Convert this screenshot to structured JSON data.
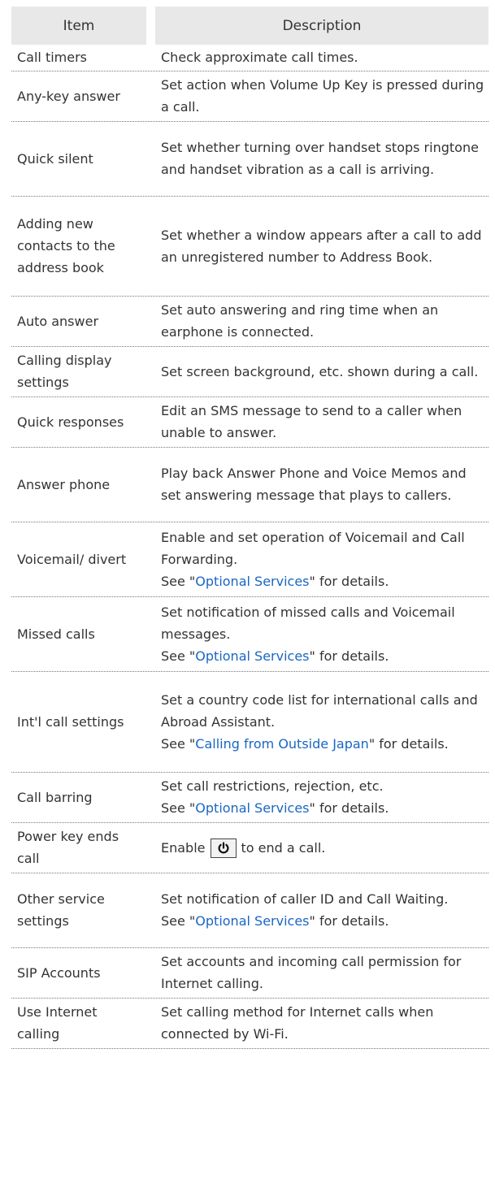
{
  "header": {
    "item": "Item",
    "description": "Description"
  },
  "rows": [
    {
      "item": "Call timers",
      "desc": "Check approximate call times."
    },
    {
      "item": "Any-key answer",
      "desc": "Set action when Volume Up Key is pressed during a call."
    },
    {
      "item": "Quick silent",
      "desc": "Set whether turning over handset stops ringtone and handset vibration as a call is arriving."
    },
    {
      "item": "Adding new contacts to the address book",
      "desc": "Set whether a window appears after a call to add an unregistered number to Address Book."
    },
    {
      "item": "Auto answer",
      "desc": "Set auto answering and ring time when an earphone is connected."
    },
    {
      "item": "Calling display settings",
      "desc": "Set screen background, etc. shown during a call."
    },
    {
      "item": "Quick responses",
      "desc": "Edit an SMS message to send to a caller when unable to answer."
    },
    {
      "item": "Answer phone",
      "desc": "Play back Answer Phone and Voice Memos and set answering message that plays to callers."
    },
    {
      "item": "Voicemail/ divert",
      "desc": "Enable and set operation of Voicemail and Call Forwarding.",
      "see_prefix": "See \"",
      "see_link": "Optional Services",
      "see_suffix": "\" for details."
    },
    {
      "item": "Missed calls",
      "desc": "Set notification of missed calls and Voicemail messages.",
      "see_prefix": "See \"",
      "see_link": "Optional Services",
      "see_suffix": "\" for details."
    },
    {
      "item": "Int'l call settings",
      "desc": "Set a country code list for international calls and Abroad Assistant.",
      "see_prefix": "See \"",
      "see_link": "Calling from Outside Japan",
      "see_suffix": "\" for details."
    },
    {
      "item": "Call barring",
      "desc": "Set call restrictions, rejection, etc.",
      "see_prefix": "See \"",
      "see_link": "Optional Services",
      "see_suffix": "\" for details."
    },
    {
      "item": "Power key ends call",
      "desc_before": "Enable",
      "desc_after": "to end a call.",
      "key_icon": "power-key-icon"
    },
    {
      "item": "Other service settings",
      "desc": "Set notification of caller ID and Call Waiting.",
      "see_prefix": "See \"",
      "see_link": "Optional Services",
      "see_suffix": "\" for details."
    },
    {
      "item": "SIP Accounts",
      "desc": "Set accounts and incoming call permission for Internet calling."
    },
    {
      "item": "Use Internet calling",
      "desc": "Set calling method for Internet calls when connected by Wi-Fi."
    }
  ]
}
